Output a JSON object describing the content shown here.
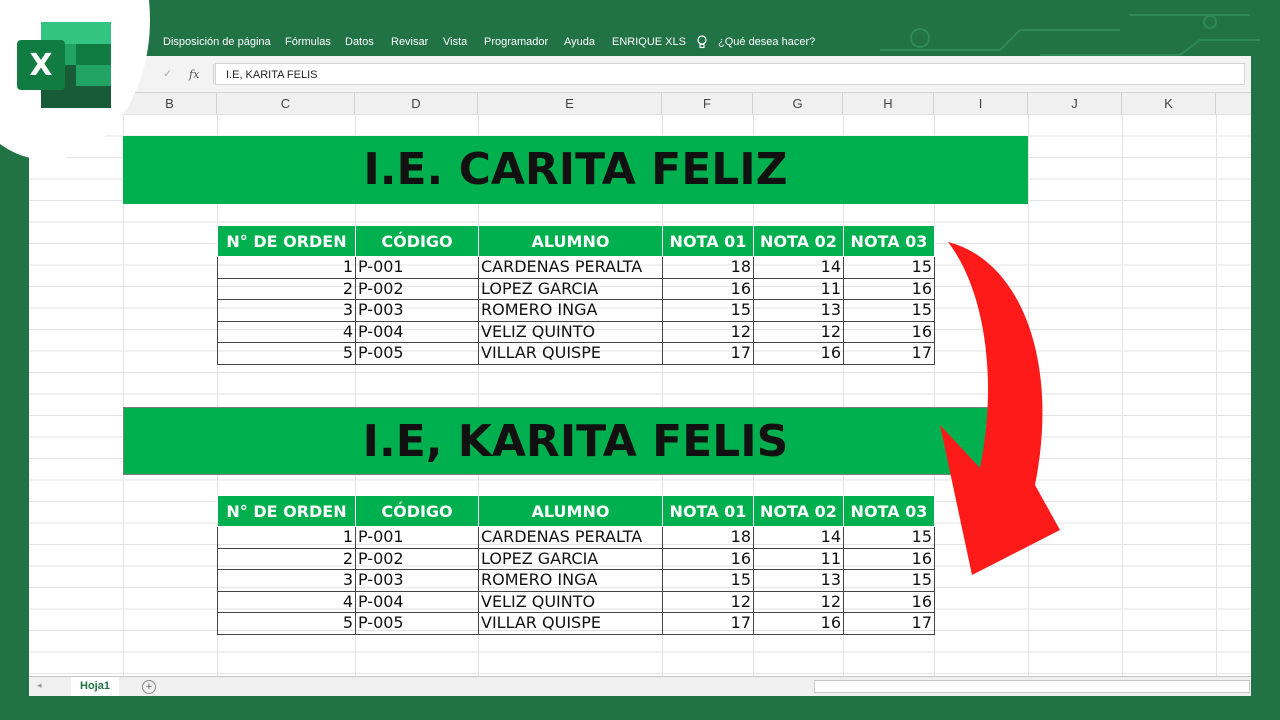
{
  "app": {
    "name": "Excel",
    "logo_letter": "X"
  },
  "ribbon": {
    "menu_items": [
      "Disposición de página",
      "Fórmulas",
      "Datos",
      "Revisar",
      "Vista",
      "Programador",
      "Ayuda",
      "ENRIQUE XLS"
    ],
    "search_placeholder": "¿Qué desea hacer?"
  },
  "formula_bar": {
    "fx_label": "fx",
    "value": "I.E, KARITA FELIS"
  },
  "columns": [
    "B",
    "C",
    "D",
    "E",
    "F",
    "G",
    "H",
    "I",
    "J",
    "K"
  ],
  "banner1": "I.E. CARITA FELIZ",
  "banner2": "I.E, KARITA FELIS",
  "table_headers": [
    "N° DE ORDEN",
    "CÓDIGO",
    "ALUMNO",
    "NOTA 01",
    "NOTA 02",
    "NOTA 03"
  ],
  "table1_rows": [
    [
      "1",
      "P-001",
      "CARDENAS PERALTA",
      "18",
      "14",
      "15"
    ],
    [
      "2",
      "P-002",
      "LOPEZ GARCIA",
      "16",
      "11",
      "16"
    ],
    [
      "3",
      "P-003",
      "ROMERO INGA",
      "15",
      "13",
      "15"
    ],
    [
      "4",
      "P-004",
      "VELIZ QUINTO",
      "12",
      "12",
      "16"
    ],
    [
      "5",
      "P-005",
      "VILLAR QUISPE",
      "17",
      "16",
      "17"
    ]
  ],
  "table2_rows": [
    [
      "1",
      "P-001",
      "CARDENAS PERALTA",
      "18",
      "14",
      "15"
    ],
    [
      "2",
      "P-002",
      "LOPEZ GARCIA",
      "16",
      "11",
      "16"
    ],
    [
      "3",
      "P-003",
      "ROMERO INGA",
      "15",
      "13",
      "15"
    ],
    [
      "4",
      "P-004",
      "VELIZ QUINTO",
      "12",
      "12",
      "16"
    ],
    [
      "5",
      "P-005",
      "VILLAR QUISPE",
      "17",
      "16",
      "17"
    ]
  ],
  "sheet_tab": "Hoja1",
  "colors": {
    "excel_green": "#217346",
    "banner_green": "#00b04f",
    "arrow_red": "#ff1a1a"
  }
}
